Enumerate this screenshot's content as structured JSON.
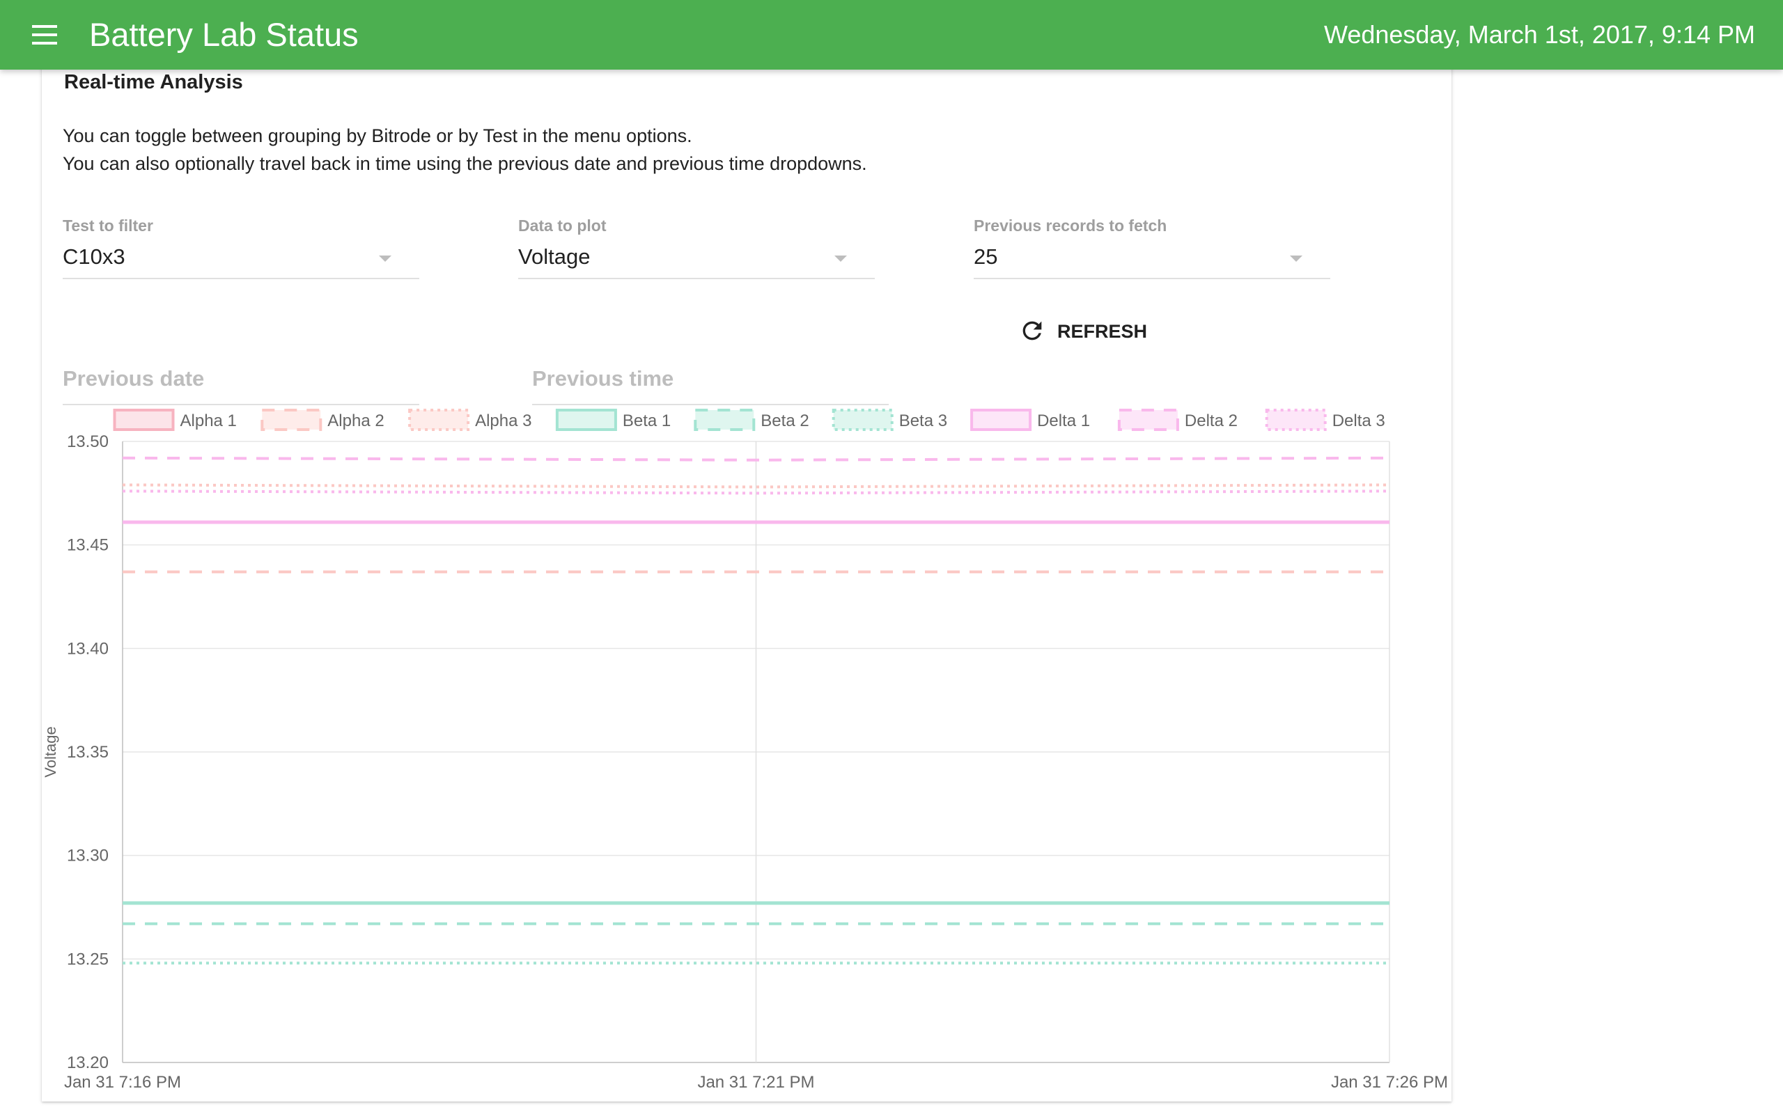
{
  "header": {
    "title": "Battery Lab Status",
    "datetime": "Wednesday, March 1st, 2017, 9:14 PM",
    "menu_icon": "hamburger-menu-icon",
    "bar_color": "#4caf50"
  },
  "card": {
    "title": "Real-time Analysis",
    "description": [
      "You can toggle between grouping by Bitrode or by Test in the menu options.",
      "You can also optionally travel back in time using the previous date and previous time dropdowns."
    ]
  },
  "filters": {
    "test": {
      "label": "Test to filter",
      "value": "C10x3"
    },
    "data": {
      "label": "Data to plot",
      "value": "Voltage"
    },
    "records": {
      "label": "Previous records to fetch",
      "value": "25"
    },
    "refresh_label": "REFRESH",
    "refresh_icon": "refresh-icon",
    "previous_date_placeholder": "Previous date",
    "previous_time_placeholder": "Previous time"
  },
  "chart_data": {
    "type": "line",
    "ylabel": "Voltage",
    "ylim": [
      13.2,
      13.5
    ],
    "y_ticks": [
      "13.50",
      "13.45",
      "13.40",
      "13.35",
      "13.30",
      "13.25",
      "13.20"
    ],
    "x": [
      "Jan 31 7:16 PM",
      "Jan 31 7:21 PM",
      "Jan 31 7:26 PM"
    ],
    "grid": true,
    "legend_position": "top",
    "series": [
      {
        "name": "Alpha 1",
        "style": "solid",
        "color": "#f7b3c0",
        "values": [
          13.461,
          13.461,
          13.461
        ]
      },
      {
        "name": "Alpha 2",
        "style": "dashed",
        "color": "#fbc8c4",
        "values": [
          13.437,
          13.437,
          13.437
        ]
      },
      {
        "name": "Alpha 3",
        "style": "dotted",
        "color": "#fbc8c4",
        "values": [
          13.479,
          13.478,
          13.479
        ]
      },
      {
        "name": "Beta 1",
        "style": "solid",
        "color": "#a3e4d2",
        "values": [
          13.277,
          13.277,
          13.277
        ]
      },
      {
        "name": "Beta 2",
        "style": "dashed",
        "color": "#a3e4d2",
        "values": [
          13.267,
          13.267,
          13.267
        ]
      },
      {
        "name": "Beta 3",
        "style": "dotted",
        "color": "#a3e4d2",
        "values": [
          13.248,
          13.248,
          13.248
        ]
      },
      {
        "name": "Delta 1",
        "style": "solid",
        "color": "#f9b8ec",
        "values": [
          13.461,
          13.461,
          13.461
        ]
      },
      {
        "name": "Delta 2",
        "style": "dashed",
        "color": "#f9b8ec",
        "values": [
          13.492,
          13.491,
          13.492
        ]
      },
      {
        "name": "Delta 3",
        "style": "dotted",
        "color": "#f9b8ec",
        "values": [
          13.476,
          13.475,
          13.476
        ]
      }
    ]
  }
}
